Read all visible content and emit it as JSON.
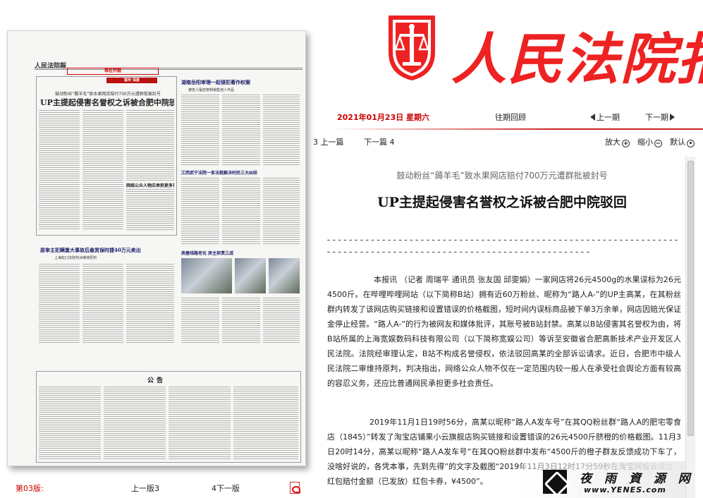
{
  "paper": {
    "masthead": "人民法院報",
    "section_banner": "现在开庭",
    "column_tag": "案件·深度",
    "lead_kicker": "鼓动粉丝“薅羊毛”致水果网店赔付700万元遭群批被封号",
    "lead_headline": "UP主提起侵害名誉权之诉被合肥中院驳回",
    "right_headline": "湖南岳阳审理一起侵犯著作权案",
    "right_sub": "被告人擅自复制销售他人作品",
    "mid_headline": "网络公众人物应承担更多社会责任",
    "right2_headline": "江西武宁法院一条法就解决村民三大纠纷",
    "bottom_headline": "原审主犯瞒重大事故后悬赏保时捷40万元卖出",
    "bottom_sub": "上海虹口法院判决维持原判",
    "right3_headline": "房屋线路老化 房主担责三成",
    "notice_heading": "公告",
    "footer": {
      "edition": "第03版:",
      "prev_edition": "上一版3",
      "next_edition": "4下一版"
    }
  },
  "header": {
    "logo_text": "人民法院报",
    "date": "2021年01月23日 星期六",
    "history_label": "往期回顾",
    "prev_period": "上一期",
    "next_period": "下一期"
  },
  "article_nav": {
    "prev_article": "3 上一篇",
    "next_article": "下一篇 4",
    "zoom_in": "放大",
    "zoom_out": "缩小",
    "default": "默认"
  },
  "article": {
    "subtitle": "鼓动粉丝“薅羊毛”致水果网店赔付700万元遭群批被封号",
    "title": "UP主提起侵害名誉权之诉被合肥中院驳回",
    "divider": "----------------------------------------------------------------------------------------------------------------",
    "paragraph1": "本报讯 （记者 周瑞平 通讯员 张友国 邱雯娟）一家网店将26元4500g的水果误标为26元4500斤。在哔哩哔哩网站（以下简称B站）拥有近60万粉丝、昵称为“路人A-”的UP主高某，在其粉丝群内转发了该网店购买链接和设置错误的价格截图，短时间内误标商品被下单3万余单，网店因赔光保证金停止经营。“路人A-”的行为被网友和媒体批评，其账号被B站封禁。高某以B站侵害其名誉权为由，将B站所属的上海宽娱数码科技有限公司（以下简称宽娱公司）等诉至安徽省合肥高新技术产业开发区人民法院。法院经审理认定，B站不构成名誉侵权，依法驳回高某的全部诉讼请求。近日，合肥市中级人民法院二审维持原判，判决指出，网络公众人物不仅在一定范围内较一般人在承受社会舆论方面有较高的容忍义务，还应比普通网民承担更多社会责任。",
    "paragraph2": "2019年11月1日19时56分，高某以昵称“路人A发车号”在其QQ粉丝群“路人A的肥宅零食店（1845）”转发了淘宝店铺果小云旗舰店购买链接和设置错误的26元4500斤脐橙的价格截图。11月3日20时14分，高某以昵称“路人A发车号”在其QQ粉丝群中发布“4500斤的橙子群友反馈成功下车了，没啥好说的，各凭本事，先到先得”的文字及截图“2019年11月3日12时17分59秒在淘宝网投诉成立，红包赔付金额（已发放）红包卡券，¥4500”。"
  },
  "watermark": {
    "script_text": "夜 雨 資 源 网",
    "url": "www.YENES.com"
  }
}
